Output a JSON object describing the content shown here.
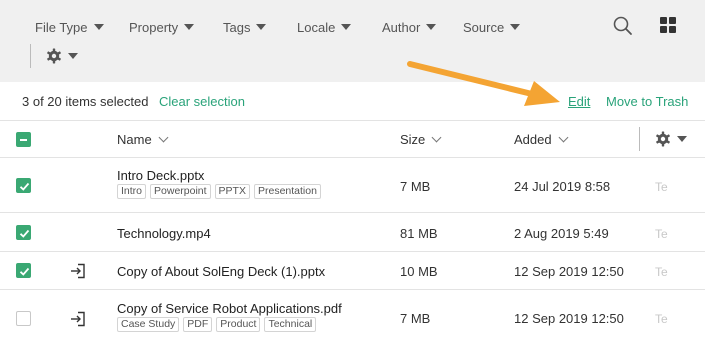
{
  "filters": [
    {
      "label": "File Type"
    },
    {
      "label": "Property"
    },
    {
      "label": "Tags"
    },
    {
      "label": "Locale"
    },
    {
      "label": "Author"
    },
    {
      "label": "Source"
    }
  ],
  "selection": {
    "count_text": "3 of 20 items selected",
    "clear_label": "Clear selection",
    "edit_label": "Edit",
    "trash_label": "Move to Trash"
  },
  "columns": {
    "name": "Name",
    "size": "Size",
    "added": "Added"
  },
  "rows": [
    {
      "name": "Intro Deck.pptx",
      "tags": [
        "Intro",
        "Powerpoint",
        "PPTX",
        "Presentation"
      ],
      "size": "7 MB",
      "added": "24 Jul 2019 8:58",
      "trunc": "Te",
      "checked": true
    },
    {
      "name": "Technology.mp4",
      "tags": [],
      "size": "81 MB",
      "added": "2 Aug 2019 5:49",
      "trunc": "Te",
      "checked": true
    },
    {
      "name": "Copy of About SolEng Deck (1).pptx",
      "tags": [],
      "size": "10 MB",
      "added": "12 Sep 2019 12:50",
      "trunc": "Te",
      "checked": true
    },
    {
      "name": "Copy of Service Robot Applications.pdf",
      "tags": [
        "Case Study",
        "PDF",
        "Product",
        "Technical"
      ],
      "size": "7 MB",
      "added": "12 Sep 2019 12:50",
      "trunc": "Te",
      "checked": false
    }
  ],
  "colors": {
    "accent": "#2aa37a",
    "checkbox": "#3aa873",
    "arrow": "#f4a433",
    "toolbar_bg": "#f0f0f0"
  },
  "icons": [
    "search-icon",
    "grid-view-icon",
    "gear-icon",
    "caret-down-icon",
    "check-in-icon",
    "chevron-down-icon"
  ]
}
